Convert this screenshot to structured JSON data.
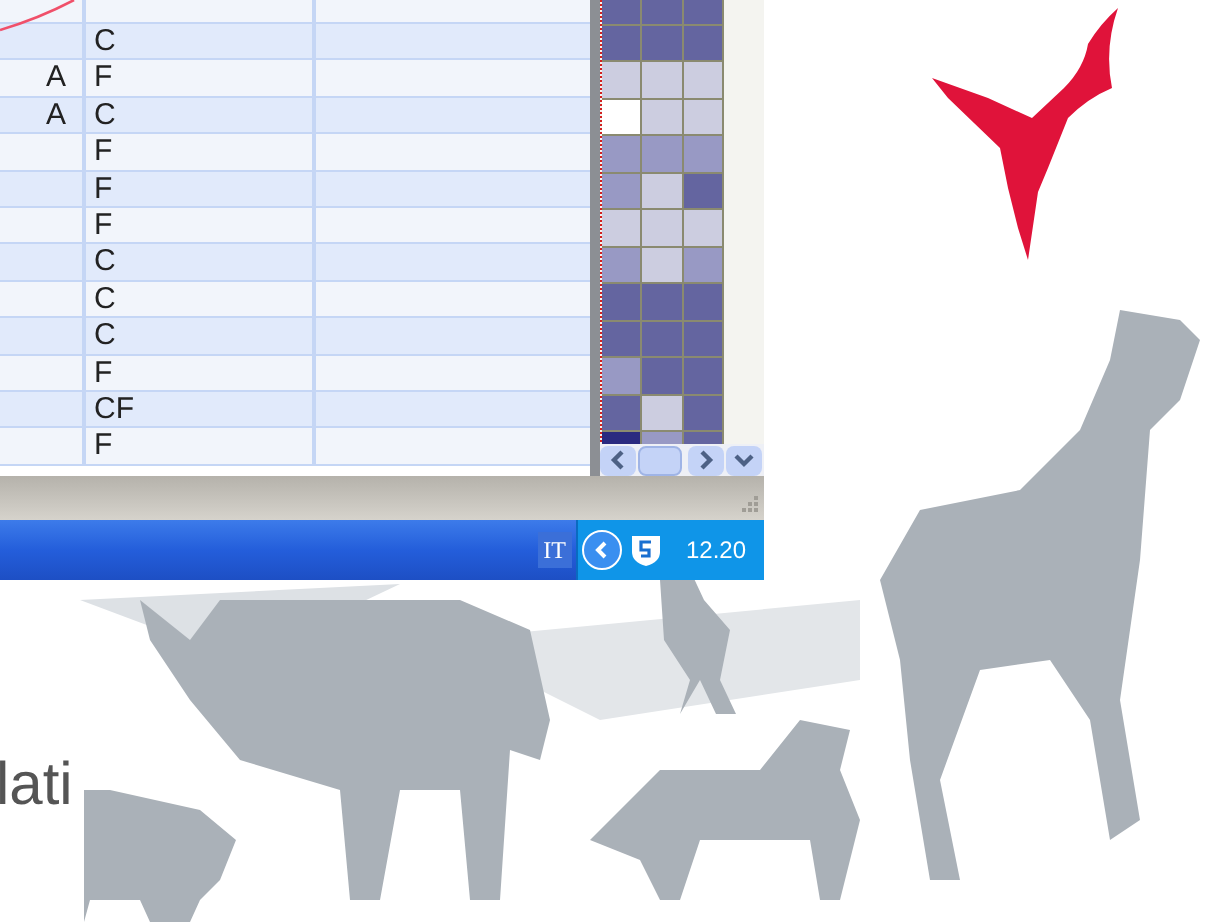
{
  "table": {
    "rows": [
      {
        "column_1": "",
        "column_2": "C"
      },
      {
        "column_1": "A",
        "column_2": "F"
      },
      {
        "column_1": "A",
        "column_2": "C"
      },
      {
        "column_1": "",
        "column_2": "F"
      },
      {
        "column_1": "",
        "column_2": "F"
      },
      {
        "column_1": "",
        "column_2": "F"
      },
      {
        "column_1": "",
        "column_2": "C"
      },
      {
        "column_1": "",
        "column_2": "C"
      },
      {
        "column_1": "",
        "column_2": "C"
      },
      {
        "column_1": "",
        "column_2": "F"
      },
      {
        "column_1": "",
        "column_2": "CF"
      },
      {
        "column_1": "",
        "column_2": "F"
      }
    ]
  },
  "heatmap": {
    "rows": [
      {
        "cells": [
          {
            "color": "#6465a0"
          },
          {
            "color": "#6465a0"
          },
          {
            "color": "#6465a0"
          }
        ]
      },
      {
        "cells": [
          {
            "color": "#6465a0"
          },
          {
            "color": "#6465a0"
          },
          {
            "color": "#6465a0"
          }
        ]
      },
      {
        "cells": [
          {
            "color": "#cccde0"
          },
          {
            "color": "#cccde0"
          },
          {
            "color": "#cccde0"
          }
        ]
      },
      {
        "cells": [
          {
            "color": "#ffffff"
          },
          {
            "color": "#cccde0"
          },
          {
            "color": "#cccde0"
          }
        ]
      },
      {
        "cells": [
          {
            "color": "#9899c4"
          },
          {
            "color": "#9899c4"
          },
          {
            "color": "#9899c4"
          }
        ]
      },
      {
        "cells": [
          {
            "color": "#9899c4"
          },
          {
            "color": "#cccde0"
          },
          {
            "color": "#6465a0"
          }
        ]
      },
      {
        "cells": [
          {
            "color": "#cccde0"
          },
          {
            "color": "#cccde0"
          },
          {
            "color": "#cccde0"
          }
        ]
      },
      {
        "cells": [
          {
            "color": "#9899c4"
          },
          {
            "color": "#cccde0"
          },
          {
            "color": "#9899c4"
          }
        ]
      },
      {
        "cells": [
          {
            "color": "#6465a0"
          },
          {
            "color": "#6465a0"
          },
          {
            "color": "#6465a0"
          }
        ]
      },
      {
        "cells": [
          {
            "color": "#6465a0"
          },
          {
            "color": "#6465a0"
          },
          {
            "color": "#6465a0"
          }
        ]
      },
      {
        "cells": [
          {
            "color": "#9899c4"
          },
          {
            "color": "#6465a0"
          },
          {
            "color": "#6465a0"
          }
        ]
      },
      {
        "cells": [
          {
            "color": "#6465a0"
          },
          {
            "color": "#cccde0"
          },
          {
            "color": "#6465a0"
          }
        ]
      },
      {
        "cells": [
          {
            "color": "#2a2a80"
          },
          {
            "color": "#9899c4"
          },
          {
            "color": "#6465a0"
          }
        ]
      }
    ]
  },
  "taskbar": {
    "language": "IT",
    "clock": "12.20"
  },
  "background_text": "lati"
}
